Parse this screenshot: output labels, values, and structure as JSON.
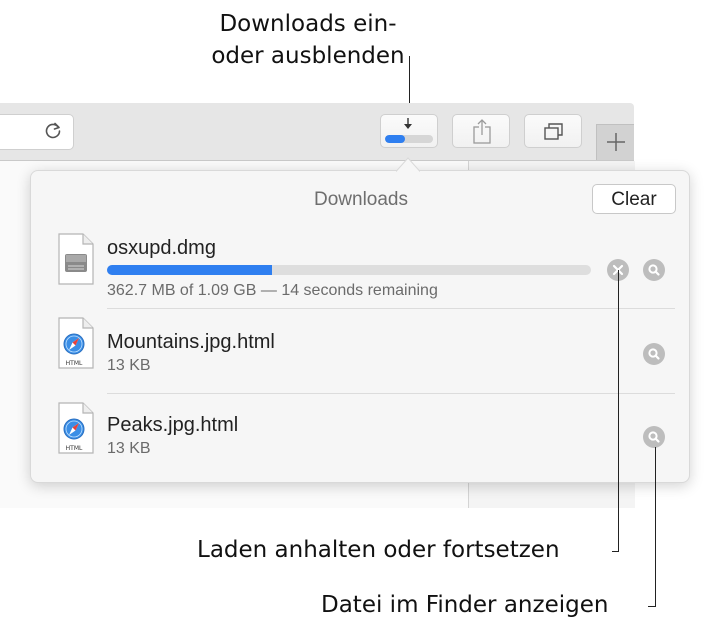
{
  "callouts": {
    "toggle_downloads_line1": "Downloads ein-",
    "toggle_downloads_line2": "oder ausblenden",
    "pause_resume": "Laden anhalten oder fortsetzen",
    "show_in_finder": "Datei im Finder anzeigen"
  },
  "toolbar": {
    "download_progress": 0.42
  },
  "downloads": {
    "title": "Downloads",
    "clear_label": "Clear",
    "items": [
      {
        "name": "osxupd.dmg",
        "status": "362.7 MB of 1.09 GB — 14 seconds remaining",
        "progress": 0.34,
        "icon": "disk-image-icon"
      },
      {
        "name": "Mountains.jpg.html",
        "status": "13 KB",
        "icon": "html-document-icon",
        "icon_label": "HTML"
      },
      {
        "name": "Peaks.jpg.html",
        "status": "13 KB",
        "icon": "html-document-icon",
        "icon_label": "HTML"
      }
    ]
  },
  "colors": {
    "accent": "#2f7ff0",
    "icon_gray": "#bdbdbd"
  }
}
